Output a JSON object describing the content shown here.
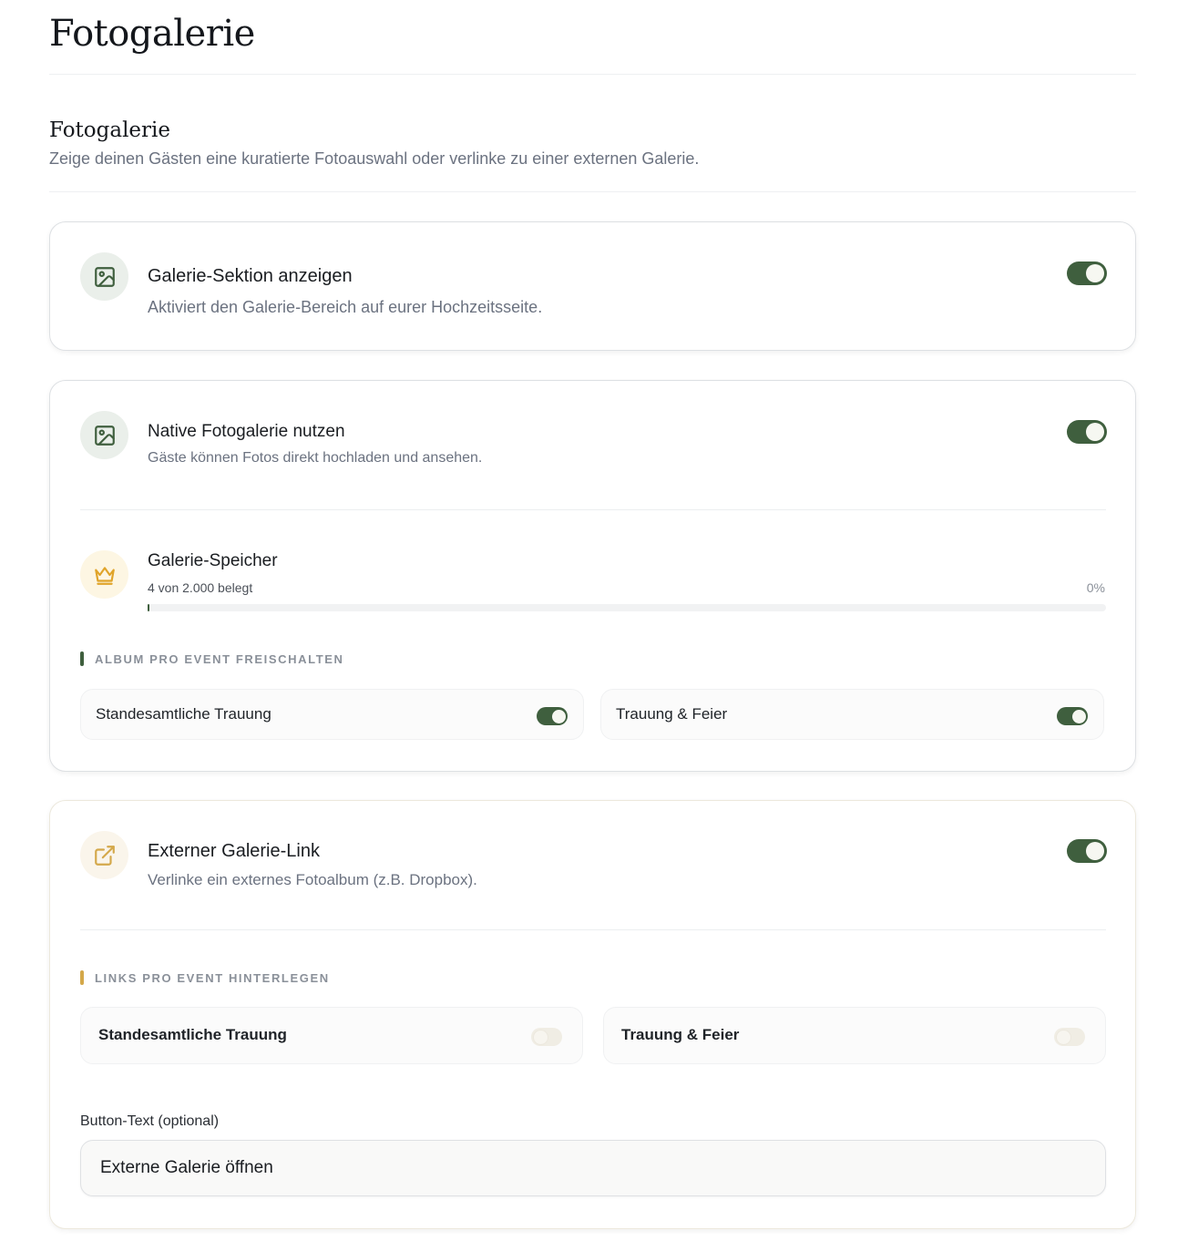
{
  "page": {
    "title": "Fotogalerie"
  },
  "section": {
    "title": "Fotogalerie",
    "subtitle": "Zeige deinen Gästen eine kuratierte Fotoauswahl oder verlinke zu einer externen Galerie."
  },
  "cards": {
    "show_section": {
      "icon": "image-icon",
      "title": "Galerie-Sektion anzeigen",
      "subtitle": "Aktiviert den Galerie-Bereich auf eurer Hochzeitsseite.",
      "enabled": true
    },
    "native_gallery": {
      "icon": "image-icon",
      "title": "Native Fotogalerie nutzen",
      "subtitle": "Gäste können Fotos direkt hochladen und ansehen.",
      "enabled": true,
      "storage": {
        "icon": "crown-icon",
        "title": "Galerie-Speicher",
        "usage_text": "4 von 2.000 belegt",
        "percent_text": "0%",
        "used": 4,
        "total": 2000
      },
      "album_heading": "ALBUM PRO EVENT FREISCHALTEN",
      "events": [
        {
          "label": "Standesamtliche Trauung",
          "enabled": true
        },
        {
          "label": "Trauung & Feier",
          "enabled": true
        }
      ]
    },
    "external_link": {
      "icon": "external-link-icon",
      "title": "Externer Galerie-Link",
      "subtitle": "Verlinke ein externes Fotoalbum (z.B. Dropbox).",
      "enabled": true,
      "links_heading": "LINKS PRO EVENT HINTERLEGEN",
      "events": [
        {
          "label": "Standesamtliche Trauung",
          "enabled": false
        },
        {
          "label": "Trauung & Feier",
          "enabled": false
        }
      ],
      "button_text_label": "Button-Text (optional)",
      "button_text_value": "Externe Galerie öffnen"
    }
  },
  "colors": {
    "toggle_on": "#3f5f3e",
    "accent_green": "#3f5f3e",
    "accent_gold": "#d4a84a",
    "crown": "#e0a42a"
  }
}
